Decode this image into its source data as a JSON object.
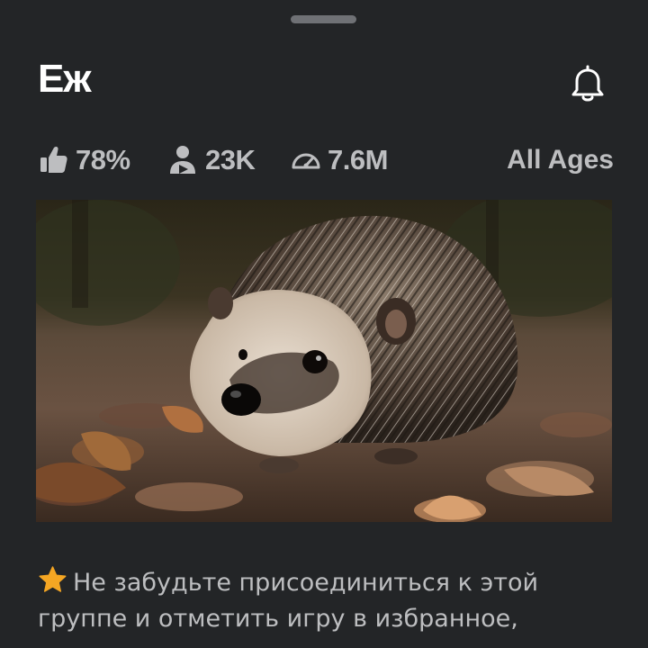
{
  "sheet": {
    "title": "Еж"
  },
  "stats": {
    "rating": "78%",
    "players": "23K",
    "visits": "7.6M",
    "age_rating": "All Ages"
  },
  "icons": {
    "bell": "bell-icon",
    "rating": "thumbs-up-icon",
    "players": "player-icon",
    "visits": "speedometer-icon",
    "star": "star-icon"
  },
  "description": {
    "line1": "Не забудьте присоединиться к этой",
    "line2": "группе и отметить игру в избранное,"
  },
  "colors": {
    "background": "#232527",
    "text_primary": "#ffffff",
    "text_secondary": "#bdbec0",
    "star": "#f5a623"
  }
}
